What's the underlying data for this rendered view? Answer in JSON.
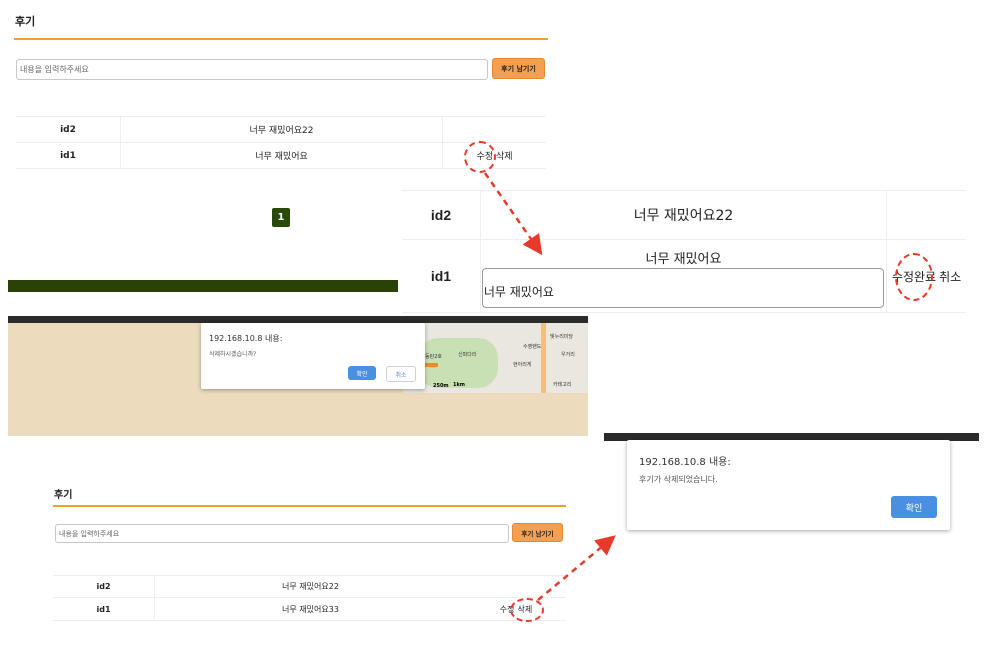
{
  "panel1": {
    "title": "후기",
    "input_placeholder": "내용을 입력하주세요",
    "submit_label": "후기 남기기",
    "rows": [
      {
        "id": "id2",
        "content": "너무 재밌어요22",
        "actions": ""
      },
      {
        "id": "id1",
        "content": "너무 재밌어요",
        "edit": "수정",
        "delete": "삭제"
      }
    ],
    "page": "1"
  },
  "edit_panel": {
    "rows": [
      {
        "id": "id2",
        "content": "너무 재밌어요22"
      },
      {
        "id": "id1",
        "content": "너무 재밌어요",
        "input_value": "너무 재밌어요",
        "save": "수정완료",
        "cancel": "취소"
      }
    ]
  },
  "confirm_dialog": {
    "title": "192.168.10.8 내용:",
    "message": "삭제하시겠습니까?",
    "ok": "확인",
    "cancel": "취소",
    "map_labels": [
      "수영랜도",
      "빛누리미당",
      "신파다리",
      "우거리",
      "현아리게",
      "동탄2호",
      "카테고리",
      "250m",
      "1km"
    ]
  },
  "alert_dialog": {
    "title": "192.168.10.8 내용:",
    "message": "후기가 삭제되었습니다.",
    "ok": "확인"
  },
  "panel2": {
    "title": "후기",
    "input_placeholder": "내용을 입력하주세요",
    "submit_label": "후기 남기기",
    "rows": [
      {
        "id": "id2",
        "content": "너무 재밌어요22"
      },
      {
        "id": "id1",
        "content": "너무 재밌어요33",
        "edit": "수정",
        "delete": "삭제"
      }
    ]
  },
  "colors": {
    "accent": "#f0a030",
    "button": "#f5a050",
    "pager": "#2a4a0a",
    "annotation": "#e83a2a",
    "dialog_button": "#4a90e2",
    "map_bg": "#eddbbd"
  }
}
